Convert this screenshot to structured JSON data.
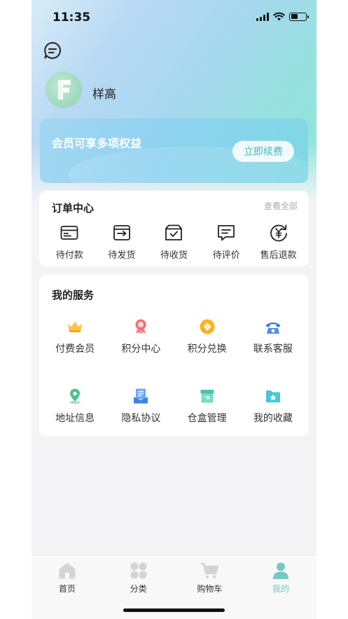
{
  "status_bar": {
    "time": "11:35"
  },
  "profile": {
    "username": "样高",
    "avatar_letter": "F"
  },
  "vip": {
    "text": "会员可享多项权益",
    "renew_label": "立即续费"
  },
  "orders": {
    "title": "订单中心",
    "view_all": "查看全部",
    "items": [
      {
        "label": "待付款",
        "icon": "wallet-icon"
      },
      {
        "label": "待发货",
        "icon": "ship-box-icon"
      },
      {
        "label": "待收货",
        "icon": "receive-box-icon"
      },
      {
        "label": "待评价",
        "icon": "comment-icon"
      },
      {
        "label": "售后退款",
        "icon": "refund-icon"
      }
    ]
  },
  "services": {
    "title": "我的服务",
    "items": [
      {
        "label": "付费会员",
        "icon": "crown-icon"
      },
      {
        "label": "积分中心",
        "icon": "medal-icon"
      },
      {
        "label": "积分兑换",
        "icon": "coin-icon"
      },
      {
        "label": "联系客服",
        "icon": "phone-icon"
      },
      {
        "label": "地址信息",
        "icon": "location-icon"
      },
      {
        "label": "隐私协议",
        "icon": "document-icon"
      },
      {
        "label": "仓盒管理",
        "icon": "box-icon"
      },
      {
        "label": "我的收藏",
        "icon": "star-folder-icon"
      }
    ]
  },
  "tabbar": {
    "items": [
      {
        "label": "首页",
        "icon": "home-icon"
      },
      {
        "label": "分类",
        "icon": "category-icon"
      },
      {
        "label": "购物车",
        "icon": "cart-icon"
      },
      {
        "label": "我的",
        "icon": "user-icon",
        "active": true
      }
    ]
  },
  "colors": {
    "accent": "#73c9c1",
    "inactive_icon": "#d4d4d4",
    "vip_card": "#8fd2f0"
  }
}
